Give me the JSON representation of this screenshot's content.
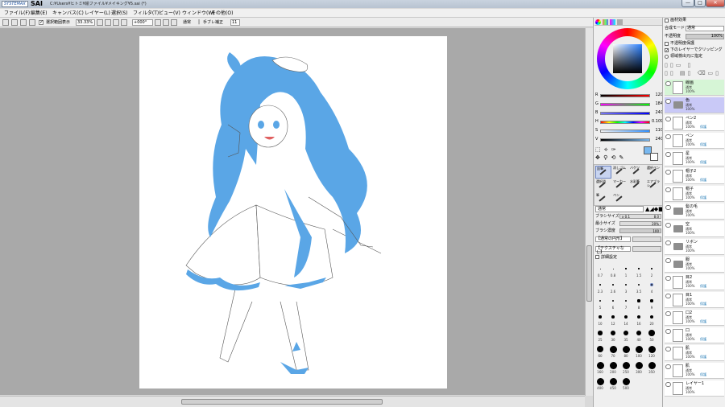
{
  "window": {
    "logo_text": "SYSTEMAX",
    "app_name": "SAI",
    "path": "C:¥Users¥ヒトミ¥絵ファイル¥メイキング¥5.sai (*)",
    "minimize": "—",
    "maximize": "□",
    "close": "✕"
  },
  "menu": [
    "ファイル(F)",
    "編集(E)",
    "キャンバス(C)",
    "レイヤー(L)",
    "選択(S)",
    "フィルタ(T)",
    "ビュー(V)",
    "ウィンドウ(W)",
    "その他(O)"
  ],
  "toolbar": {
    "selection_checkbox_label": "選択範囲表示",
    "zoom": "33.33%",
    "rotation": "+000°",
    "blend_mode": "通常",
    "stabilizer_label": "手ブレ補正",
    "stabilizer_value": "11"
  },
  "colors": {
    "hair": "#5aa6e6",
    "current_color": "#78b8f0",
    "accent": "#2a7fb8"
  },
  "sliders": [
    {
      "label": "R",
      "value": "120",
      "colors": [
        "#000000",
        "#ff0000"
      ]
    },
    {
      "label": "G",
      "value": "184",
      "colors": [
        "#ff00ff",
        "#00ff00"
      ]
    },
    {
      "label": "B",
      "value": "240",
      "colors": [
        "#7878f0",
        "#0000ff"
      ]
    },
    {
      "label": "H",
      "value": "0.109",
      "colors": [
        "#ff0000",
        "#ffff00",
        "#00ff00",
        "#00ffff",
        "#0000ff",
        "#ff00ff",
        "#ff0000"
      ]
    },
    {
      "label": "S",
      "value": "110",
      "colors": [
        "#f0f0f0",
        "#3090ff"
      ]
    },
    {
      "label": "V",
      "value": "240",
      "colors": [
        "#000000",
        "#78b8f0"
      ]
    }
  ],
  "tools": [
    {
      "name": "鉛筆",
      "icon": "pencil-icon"
    },
    {
      "name": "消しゴム",
      "icon": "eraser-icon"
    },
    {
      "name": "バケツ",
      "icon": "bucket-icon"
    },
    {
      "name": "選択ペン",
      "icon": "selpen-icon"
    },
    {
      "name": "選択消",
      "icon": "selerase-icon"
    },
    {
      "name": "マーカー",
      "icon": "marker-icon"
    },
    {
      "name": "水彩筆",
      "icon": "watercolor-icon"
    },
    {
      "name": "エアブラシ",
      "icon": "airbrush-icon"
    },
    {
      "name": "筆",
      "icon": "brush-icon"
    },
    {
      "name": "ペン",
      "icon": "pen-icon"
    }
  ],
  "brush": {
    "mode": "通常",
    "size_label": "ブラシサイズ",
    "size_mult": "x 0.1",
    "size_value": "8.0",
    "min_label": "最小サイズ",
    "min_value": "20%",
    "density_label": "ブラシ濃度",
    "density_value": "100",
    "shape1": "【通常の円形】",
    "shape2": "【テクスチャなし】",
    "detail_label": "詳細設定",
    "sizes": [
      "0.7",
      "0.8",
      "1",
      "1.5",
      "2",
      "2.3",
      "2.6",
      "3",
      "3.5",
      "4",
      "5",
      "6",
      "7",
      "8",
      "9",
      "10",
      "12",
      "14",
      "16",
      "20",
      "25",
      "30",
      "35",
      "40",
      "50",
      "60",
      "70",
      "80",
      "100",
      "120",
      "160",
      "200",
      "250",
      "300",
      "350",
      "400",
      "450",
      "500"
    ]
  },
  "layers_panel": {
    "effect_label": "画材効果",
    "composite_label": "合成モード",
    "composite_value": "通常",
    "opacity_label": "不透明度",
    "opacity_value": "100%",
    "protect_label": "不透明度保護",
    "clip_label": "下のレイヤーでクリッピング",
    "source_label": "領域検出元に指定"
  },
  "layers": [
    {
      "name": "線画",
      "mode": "通常",
      "opacity": "100%",
      "protect": "",
      "folder": false,
      "bg": "#d6f5d6"
    },
    {
      "name": "色",
      "mode": "通常",
      "opacity": "100%",
      "protect": "",
      "folder": true,
      "bg": "#c9c9f7"
    },
    {
      "name": "ペン2",
      "mode": "通常",
      "opacity": "100%",
      "protect": "保護",
      "folder": false,
      "bg": "#ffffff"
    },
    {
      "name": "ペン",
      "mode": "通常",
      "opacity": "100%",
      "protect": "保護",
      "folder": false,
      "bg": "#ffffff"
    },
    {
      "name": "星",
      "mode": "通常",
      "opacity": "100%",
      "protect": "保護",
      "folder": false,
      "bg": "#ffffff"
    },
    {
      "name": "帽子2",
      "mode": "通常",
      "opacity": "100%",
      "protect": "保護",
      "folder": false,
      "bg": "#ffffff"
    },
    {
      "name": "帽子",
      "mode": "通常",
      "opacity": "100%",
      "protect": "保護",
      "folder": false,
      "bg": "#ffffff"
    },
    {
      "name": "髪の毛",
      "mode": "通常",
      "opacity": "100%",
      "protect": "",
      "folder": true,
      "bg": "#ffffff"
    },
    {
      "name": "空",
      "mode": "通常",
      "opacity": "100%",
      "protect": "",
      "folder": true,
      "bg": "#ffffff"
    },
    {
      "name": "リボン",
      "mode": "通常",
      "opacity": "100%",
      "protect": "",
      "folder": true,
      "bg": "#ffffff"
    },
    {
      "name": "服",
      "mode": "通常",
      "opacity": "100%",
      "protect": "",
      "folder": true,
      "bg": "#ffffff"
    },
    {
      "name": "目2",
      "mode": "通常",
      "opacity": "100%",
      "protect": "保護",
      "folder": false,
      "bg": "#ffffff"
    },
    {
      "name": "目1",
      "mode": "通常",
      "opacity": "100%",
      "protect": "保護",
      "folder": false,
      "bg": "#ffffff"
    },
    {
      "name": "口2",
      "mode": "通常",
      "opacity": "100%",
      "protect": "保護",
      "folder": false,
      "bg": "#ffffff"
    },
    {
      "name": "口",
      "mode": "通常",
      "opacity": "100%",
      "protect": "保護",
      "folder": false,
      "bg": "#ffffff"
    },
    {
      "name": "肌",
      "mode": "通常",
      "opacity": "100%",
      "protect": "保護",
      "folder": false,
      "bg": "#ffffff"
    },
    {
      "name": "肌",
      "mode": "通常",
      "opacity": "100%",
      "protect": "保護",
      "folder": false,
      "bg": "#ffffff"
    },
    {
      "name": "レイヤー1",
      "mode": "通常",
      "opacity": "100%",
      "protect": "",
      "folder": false,
      "bg": "#ffffff"
    }
  ]
}
